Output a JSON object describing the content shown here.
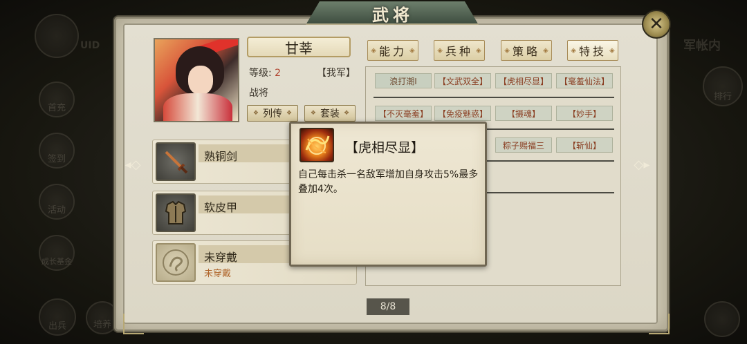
{
  "window_title": "武将",
  "general": {
    "name": "甘莘",
    "level_label": "等级:",
    "level_value": "2",
    "faction": "【我军】",
    "rank": "战将"
  },
  "buttons": {
    "biography": "列传",
    "outfit_set": "套装",
    "close": "✕"
  },
  "tabs": [
    {
      "label": "能力"
    },
    {
      "label": "兵种"
    },
    {
      "label": "策略"
    },
    {
      "label": "特技"
    }
  ],
  "equipment": [
    {
      "name": "熟铜剑",
      "icon": "sword-icon"
    },
    {
      "name": "软皮甲",
      "icon": "armor-icon"
    },
    {
      "name": "未穿戴",
      "sub": "未穿戴",
      "icon": "dragon-emblem-icon"
    }
  ],
  "skills": {
    "row1": [
      "浪打潮Ⅰ",
      "【文武双全】",
      "【虎相尽显】",
      "【毫羞仙法】"
    ],
    "row2": [
      "【不灭毫羞】",
      "【免疫魅惑】",
      "【摄魂】",
      "【妙手】"
    ],
    "row3": [
      "粽子赐福三",
      "【斩仙】"
    ]
  },
  "tooltip": {
    "title": "【虎相尽显】",
    "description": "自己每击杀一名敌军增加自身攻击5%最多叠加4次。",
    "icon": "tiger-flame-icon"
  },
  "pager": "8/8",
  "background": {
    "right_label": "军帐内",
    "left_labels": [
      "首充",
      "签到",
      "活动",
      "成长基金",
      "出兵",
      "培养"
    ],
    "right_circle_label": "排行",
    "uid_label": "UID"
  },
  "colors": {
    "accent_red": "#b0412c",
    "skill_text": "#8a3e22",
    "frame": "#cfc9b5"
  }
}
